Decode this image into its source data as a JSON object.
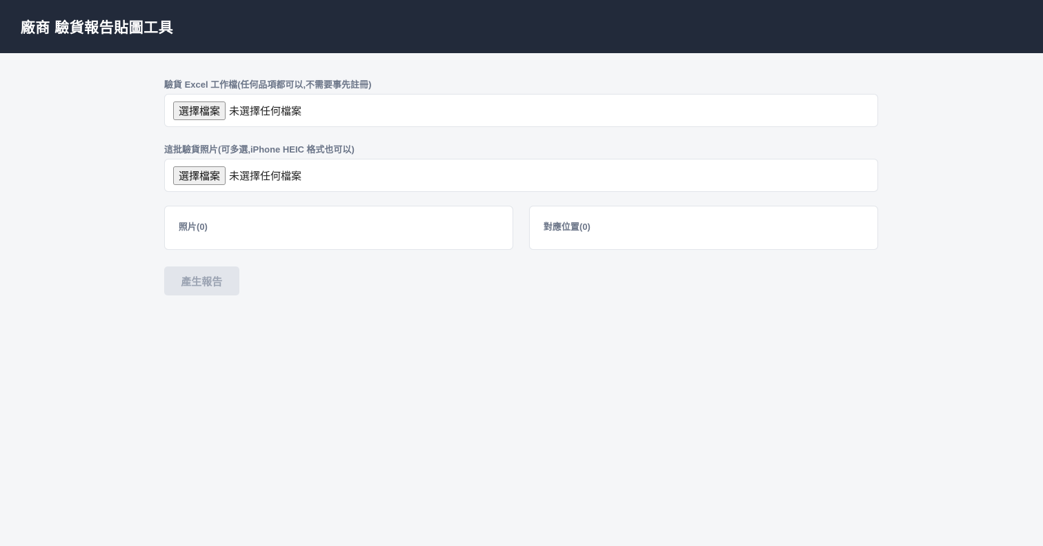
{
  "header": {
    "title": "廠商 驗貨報告貼圖工具"
  },
  "excel_upload": {
    "label": "驗貨 Excel 工作檔(任何品項都可以,不需要事先註冊)",
    "button_label": "選擇檔案",
    "status": "未選擇任何檔案"
  },
  "photo_upload": {
    "label": "這批驗貨照片(可多選,iPhone HEIC 格式也可以)",
    "button_label": "選擇檔案",
    "status": "未選擇任何檔案"
  },
  "panels": {
    "photos_title": "照片(0)",
    "positions_title": "對應位置(0)"
  },
  "actions": {
    "generate_label": "產生報告",
    "generate_enabled": false
  },
  "colors": {
    "topbar": "#222a3a",
    "background": "#f5f6f8",
    "label_text": "#6b7588",
    "disabled_button": "#e2e5eb"
  }
}
